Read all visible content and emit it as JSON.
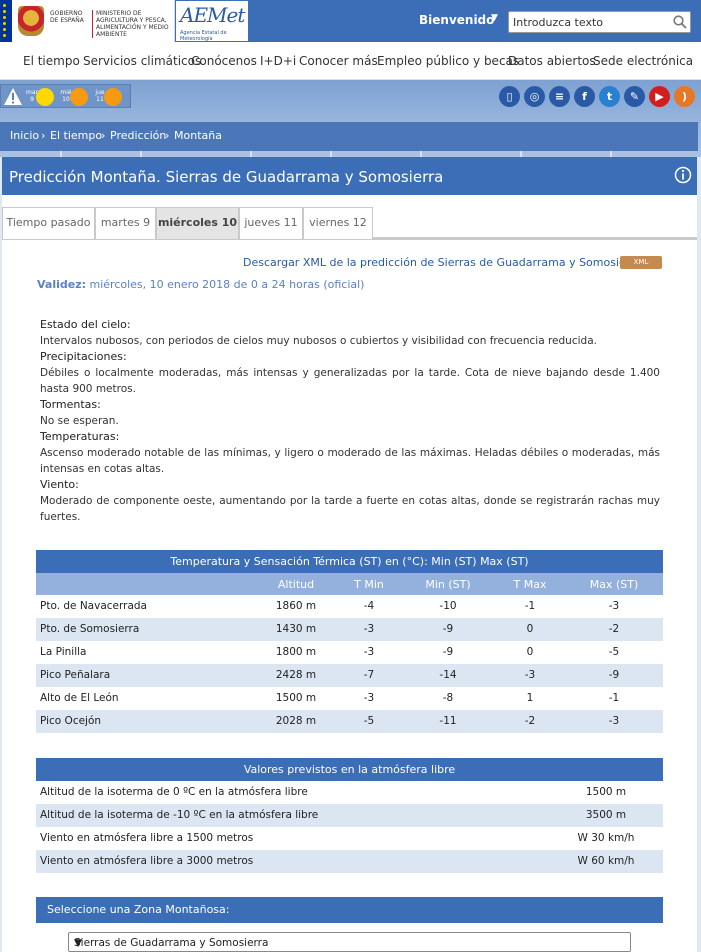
{
  "header": {
    "gov_text": "GOBIERNO DE ESPAÑA",
    "ministry_text": "MINISTERIO DE AGRICULTURA Y PESCA, ALIMENTACIÓN Y MEDIO AMBIENTE",
    "brand": "AEMet",
    "brand_sub": "Agencia Estatal de Meteorología",
    "welcome": "Bienvenido",
    "search_value": "Introduzca texto"
  },
  "nav": [
    "El tiempo",
    "Servicios climáticos",
    "Conócenos",
    "I+D+i",
    "Conocer más",
    "Empleo público y becas",
    "Datos abiertos",
    "Sede electrónica"
  ],
  "warnings": [
    {
      "day": "mar 9",
      "color": "#ffd800"
    },
    {
      "day": "mié 10",
      "color": "#f59a12"
    },
    {
      "day": "jue 11",
      "color": "#f59a12"
    }
  ],
  "social_icons": [
    "mobile-icon",
    "radar-icon",
    "list-icon",
    "facebook-icon",
    "twitter-icon",
    "blog-icon",
    "youtube-icon",
    "rss-icon"
  ],
  "breadcrumb": [
    "Inicio",
    "El tiempo",
    "Predicción",
    "Montaña"
  ],
  "page_title": "Predicción Montaña. Sierras de Guadarrama y Somosierra",
  "tabs": [
    "Tiempo pasado",
    "martes 9",
    "miércoles 10",
    "jueves 11",
    "viernes 12"
  ],
  "active_tab": "miércoles 10",
  "download_link": "Descargar XML de la predicción de Sierras de Guadarrama y Somosierra",
  "xml_badge": "XML",
  "validity_label": "Validez:",
  "validity_value": "miércoles, 10 enero 2018 de 0 a 24 horas (oficial)",
  "forecast": [
    {
      "head": "Estado del cielo:",
      "text": "Intervalos nubosos, con periodos de cielos muy nubosos o cubiertos y visibilidad con frecuencia reducida."
    },
    {
      "head": "Precipitaciones:",
      "text": "Débiles o localmente moderadas, más intensas y generalizadas por la tarde. Cota de nieve bajando desde 1.400 hasta 900 metros."
    },
    {
      "head": "Tormentas:",
      "text": "No se esperan."
    },
    {
      "head": "Temperaturas:",
      "text": "Ascenso moderado notable de las mínimas, y ligero o moderado de las máximas. Heladas débiles o moderadas, más intensas en cotas altas."
    },
    {
      "head": "Viento:",
      "text": "Moderado de componente oeste, aumentando por la tarde a fuerte en cotas altas, donde se registrarán rachas muy fuertes."
    }
  ],
  "temp_table": {
    "caption": "Temperatura y Sensación Térmica (ST) en (°C): Min (ST) Max (ST)",
    "headers": [
      "Altitud",
      "T Min",
      "Min (ST)",
      "T Max",
      "Max (ST)"
    ],
    "rows": [
      {
        "name": "Pto. de Navacerrada",
        "alt": "1860 m",
        "tmin": "-4",
        "minst": "-10",
        "tmax": "-1",
        "maxst": "-3"
      },
      {
        "name": "Pto. de Somosierra",
        "alt": "1430 m",
        "tmin": "-3",
        "minst": "-9",
        "tmax": "0",
        "maxst": "-2"
      },
      {
        "name": "La Pinilla",
        "alt": "1800 m",
        "tmin": "-3",
        "minst": "-9",
        "tmax": "0",
        "maxst": "-5"
      },
      {
        "name": "Pico Peñalara",
        "alt": "2428 m",
        "tmin": "-7",
        "minst": "-14",
        "tmax": "-3",
        "maxst": "-9"
      },
      {
        "name": "Alto de El León",
        "alt": "1500 m",
        "tmin": "-3",
        "minst": "-8",
        "tmax": "1",
        "maxst": "-1"
      },
      {
        "name": "Pico Ocejón",
        "alt": "2028 m",
        "tmin": "-5",
        "minst": "-11",
        "tmax": "-2",
        "maxst": "-3"
      }
    ]
  },
  "atm_table": {
    "caption": "Valores previstos en la atmósfera libre",
    "rows": [
      {
        "label": "Altitud de la isoterma de 0 ºC en la atmósfera libre",
        "value": "1500 m"
      },
      {
        "label": "Altitud de la isoterma de -10 ºC en la atmósfera libre",
        "value": "3500 m"
      },
      {
        "label": "Viento en atmósfera libre a 1500 metros",
        "value": "W 30 km/h"
      },
      {
        "label": "Viento en atmósfera libre a 3000 metros",
        "value": "W 60 km/h"
      }
    ]
  },
  "zone": {
    "caption": "Seleccione una Zona Montañosa:",
    "selected": "Sierras de Guadarrama y Somosierra"
  }
}
